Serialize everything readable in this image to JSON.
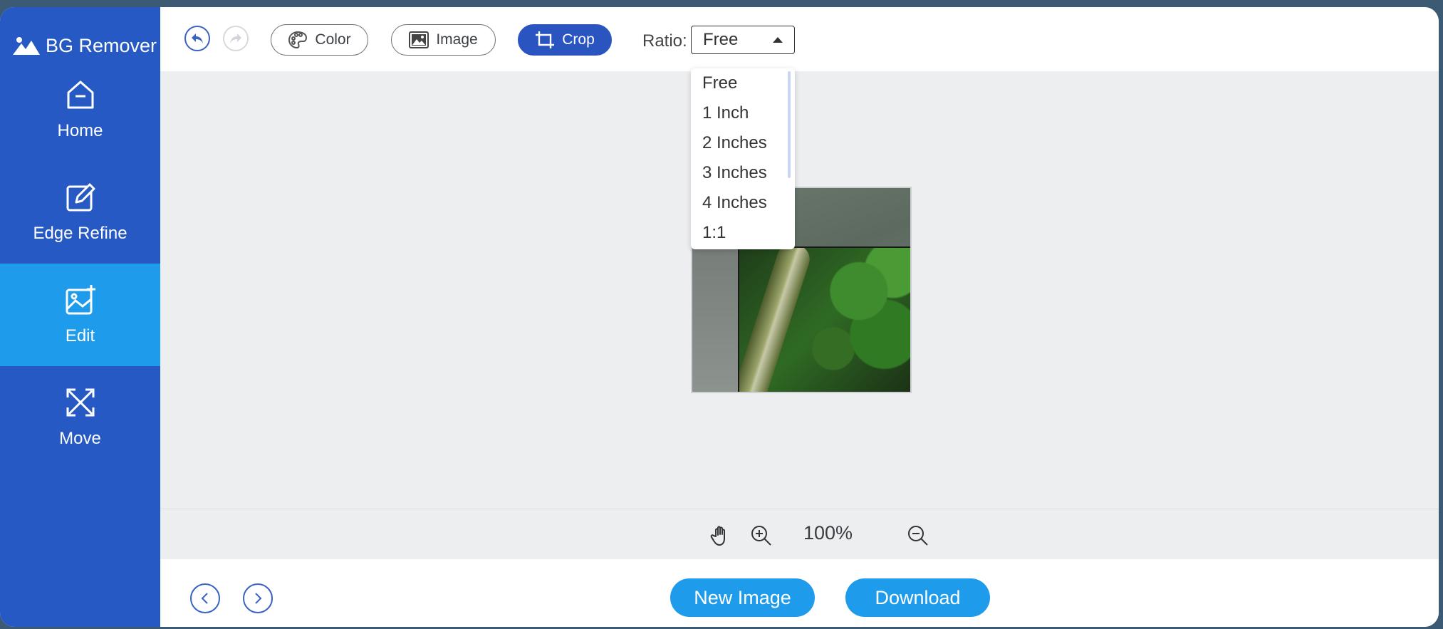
{
  "app": {
    "title": "BG Remover"
  },
  "sidebar": {
    "items": [
      {
        "label": "Home",
        "icon": "home-icon"
      },
      {
        "label": "Edge Refine",
        "icon": "edit-pen-icon"
      },
      {
        "label": "Edit",
        "icon": "image-edit-icon",
        "active": true
      },
      {
        "label": "Move",
        "icon": "move-arrows-icon"
      }
    ]
  },
  "toolbar": {
    "color_label": "Color",
    "image_label": "Image",
    "crop_label": "Crop",
    "ratio_label": "Ratio:",
    "ratio_value": "Free"
  },
  "ratio_options": [
    "Free",
    "1 Inch",
    "2 Inches",
    "3 Inches",
    "4 Inches",
    "1:1"
  ],
  "zoom": {
    "value": "100%"
  },
  "footer": {
    "new_image_label": "New Image",
    "download_label": "Download"
  },
  "colors": {
    "sidebar": "#2759c4",
    "active": "#1e9bea",
    "accent": "#2a55c0"
  }
}
